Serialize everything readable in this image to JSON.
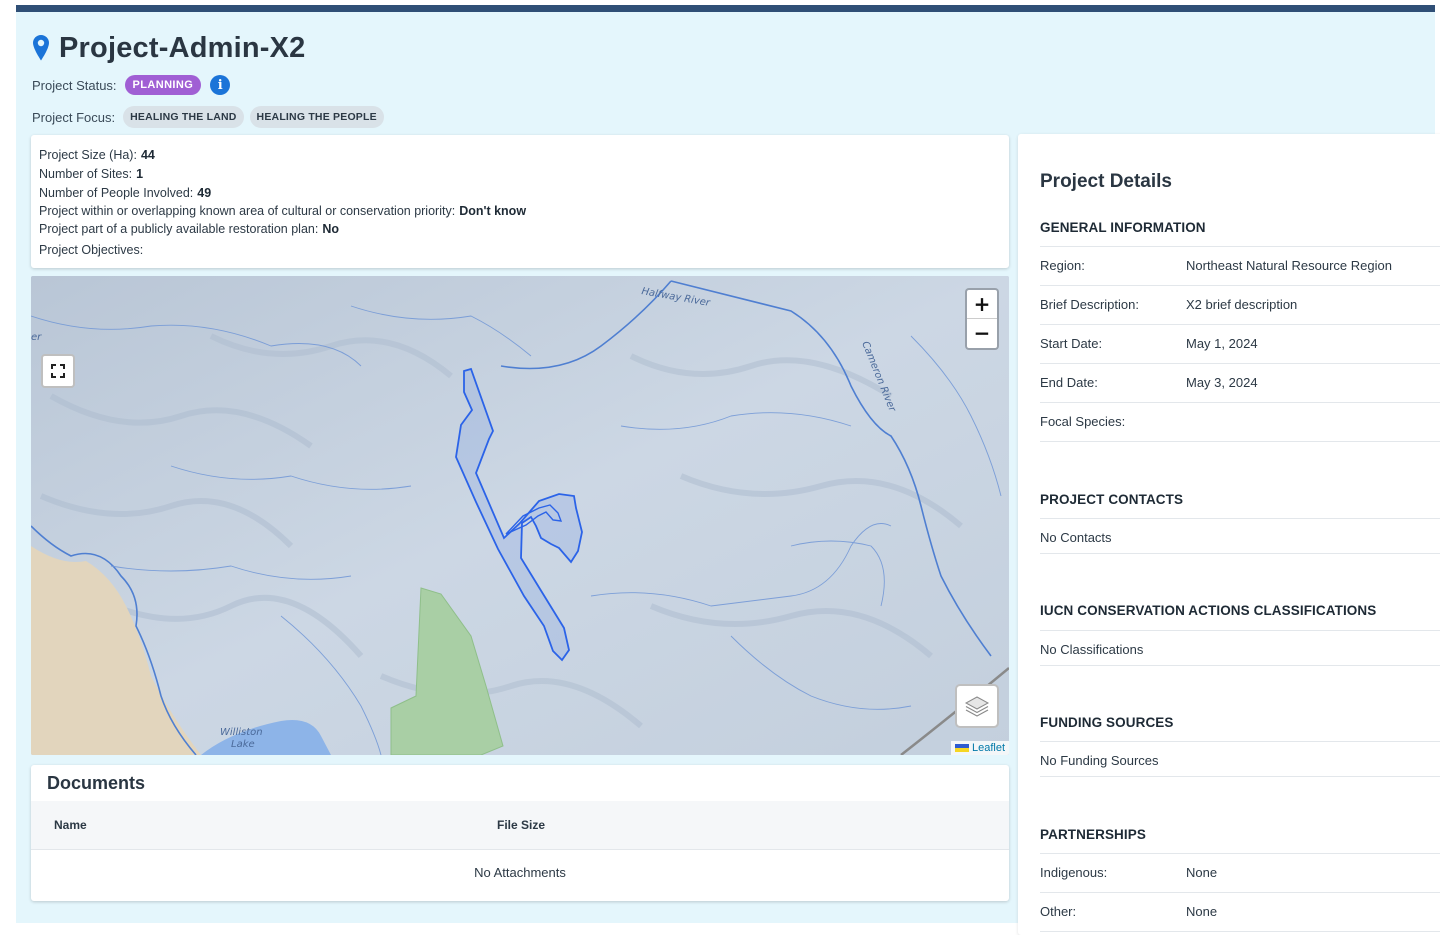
{
  "header": {
    "title": "Project-Admin-X2",
    "status_label": "Project Status:",
    "status_value": "PLANNING",
    "focus_label": "Project Focus:",
    "focus_tags": [
      "HEALING THE LAND",
      "HEALING THE PEOPLE"
    ]
  },
  "summary": {
    "size_label": "Project Size (Ha):",
    "size_value": "44",
    "sites_label": "Number of Sites:",
    "sites_value": "1",
    "people_label": "Number of People Involved:",
    "people_value": "49",
    "priority_label": "Project within or overlapping known area of cultural or conservation priority:",
    "priority_value": "Don't know",
    "plan_label": "Project part of a publicly available restoration plan:",
    "plan_value": "No",
    "objectives_label": "Project Objectives:"
  },
  "map": {
    "zoom_in": "+",
    "zoom_out": "−",
    "attribution": "Leaflet",
    "labels": {
      "halfway_river": "Halfway River",
      "cameron_river": "Cameron River",
      "williston_lake_1": "Williston",
      "williston_lake_2": "Lake",
      "edge_text": "er"
    }
  },
  "documents": {
    "title": "Documents",
    "col_name": "Name",
    "col_size": "File Size",
    "empty": "No Attachments"
  },
  "details": {
    "title": "Project Details",
    "general": {
      "heading": "GENERAL INFORMATION",
      "rows": [
        {
          "k": "Region:",
          "v": "Northeast Natural Resource Region"
        },
        {
          "k": "Brief Description:",
          "v": "X2 brief description"
        },
        {
          "k": "Start Date:",
          "v": "May 1, 2024"
        },
        {
          "k": "End Date:",
          "v": "May 3, 2024"
        },
        {
          "k": "Focal Species:",
          "v": ""
        }
      ]
    },
    "contacts": {
      "heading": "PROJECT CONTACTS",
      "empty": "No Contacts"
    },
    "iucn": {
      "heading": "IUCN CONSERVATION ACTIONS CLASSIFICATIONS",
      "empty": "No Classifications"
    },
    "funding": {
      "heading": "FUNDING SOURCES",
      "empty": "No Funding Sources"
    },
    "partnerships": {
      "heading": "PARTNERSHIPS",
      "rows": [
        {
          "k": "Indigenous:",
          "v": "None"
        },
        {
          "k": "Other:",
          "v": "None"
        }
      ]
    }
  },
  "colors": {
    "status_badge": "#a05fd4",
    "info_icon": "#1b74d8",
    "header_bg": "#e4f6fc",
    "topbar": "#2f4f76",
    "polygon": "#2b63e8"
  },
  "icons": [
    "map-pin-icon",
    "info-icon",
    "fullscreen-icon",
    "layers-icon"
  ]
}
